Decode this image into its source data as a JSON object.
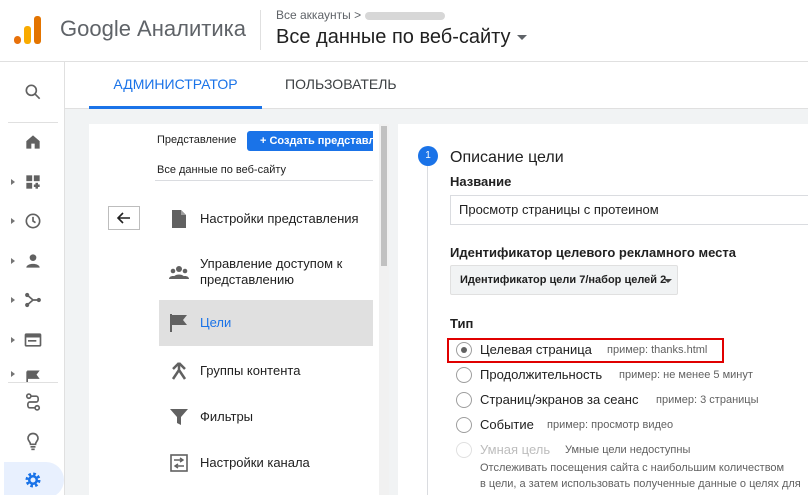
{
  "header": {
    "brand": "Google Аналитика",
    "breadcrumb": "Все аккаунты >",
    "view_title": "Все данные по веб-сайту"
  },
  "rail": {
    "icons": [
      "search-icon",
      "home-icon",
      "customization-icon",
      "clock-icon",
      "person-icon",
      "acquisition-icon",
      "behavior-icon",
      "conversions-icon",
      "attribution-icon",
      "lightbulb-icon",
      "gear-icon"
    ]
  },
  "tabs": {
    "admin": "АДМИНИСТРАТОР",
    "user": "ПОЛЬЗОВАТЕЛЬ"
  },
  "view_column": {
    "label": "Представление",
    "create_button": "+ Создать представление",
    "view_name": "Все данные по веб-сайту",
    "menu": [
      {
        "label": "Настройки представления",
        "icon": "document-icon"
      },
      {
        "label": "Управление доступом к представлению",
        "icon": "people-icon"
      },
      {
        "label": "Цели",
        "icon": "flag-icon"
      },
      {
        "label": "Группы контента",
        "icon": "content-grouping-icon"
      },
      {
        "label": "Фильтры",
        "icon": "filter-icon"
      },
      {
        "label": "Настройки канала",
        "icon": "channel-settings-icon"
      }
    ]
  },
  "goal": {
    "step_number": "1",
    "step_title": "Описание цели",
    "name_label": "Название",
    "name_value": "Просмотр страницы с протеином",
    "slot_label": "Идентификатор целевого рекламного места",
    "slot_value": "Идентификатор цели 7/набор целей 2",
    "type_label": "Тип",
    "options": [
      {
        "label": "Целевая страница",
        "hint": "пример: thanks.html"
      },
      {
        "label": "Продолжительность",
        "hint": "пример: не менее 5 минут"
      },
      {
        "label": "Страниц/экранов за сеанс",
        "hint": "пример: 3 страницы"
      },
      {
        "label": "Событие",
        "hint": "пример: просмотр видео"
      },
      {
        "label": "Умная цель",
        "hint": "Умные цели недоступны"
      }
    ],
    "smart_desc_1": "Отслеживать посещения сайта с наибольшим количеством",
    "smart_desc_2": "в цели, а затем использовать полученные данные о целях для"
  },
  "colors": {
    "accent": "#1a73e8",
    "highlight": "#e00000"
  }
}
